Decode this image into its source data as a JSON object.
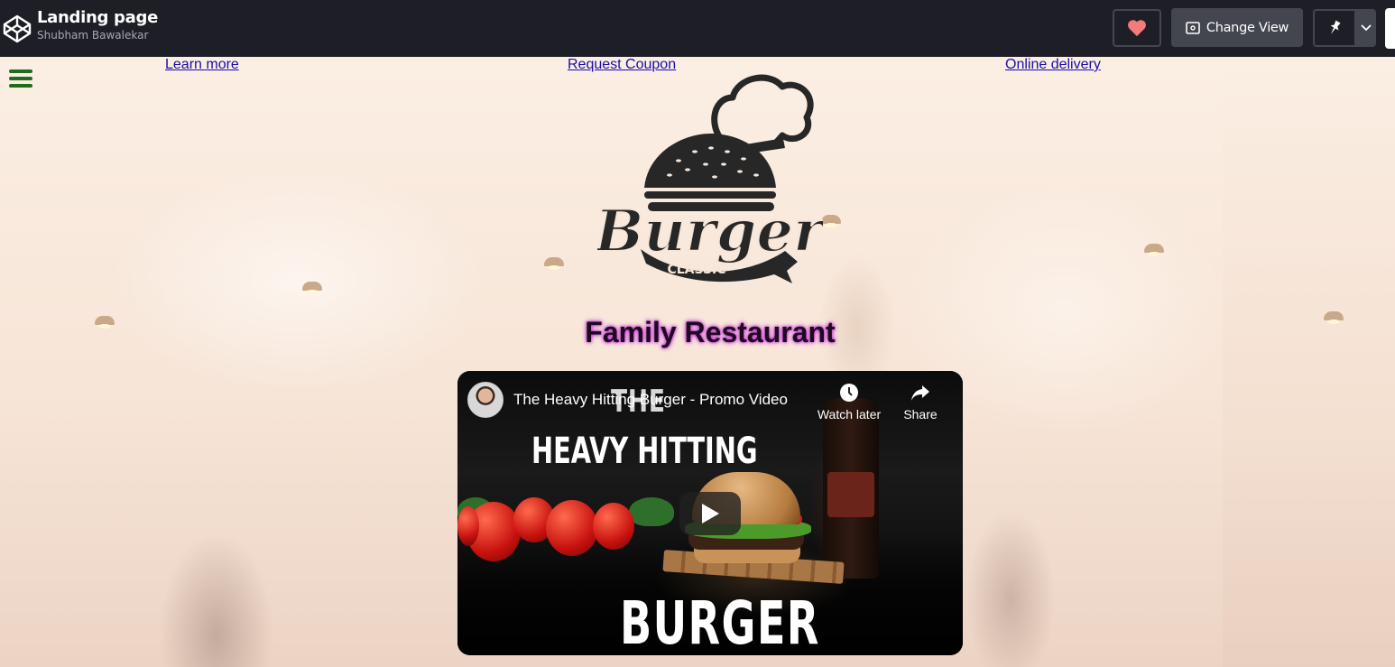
{
  "topbar": {
    "title": "Landing page",
    "author": "Shubham Bawalekar",
    "change_view_label": "Change View",
    "colors": {
      "background": "#1e1f26",
      "heart": "#f47b7b",
      "button": "#44464f"
    }
  },
  "nav": {
    "links": [
      "Learn more",
      "Request Coupon",
      "Online delivery"
    ],
    "menu_icon": "hamburger-menu-icon",
    "menu_color": "#1f6b1f"
  },
  "logo": {
    "wordmark": "Burger",
    "tagline": "CLASSIC",
    "color": "#272727"
  },
  "hero": {
    "title": "Family Restaurant",
    "glow_color": "#c22bd6"
  },
  "video": {
    "title": "The Heavy Hitting Burger - Promo Video",
    "watch_later_label": "Watch later",
    "share_label": "Share",
    "thumbnail_text": {
      "line1": "THE",
      "line2": "HEAVY HITTING",
      "line3": "BURGER"
    }
  }
}
